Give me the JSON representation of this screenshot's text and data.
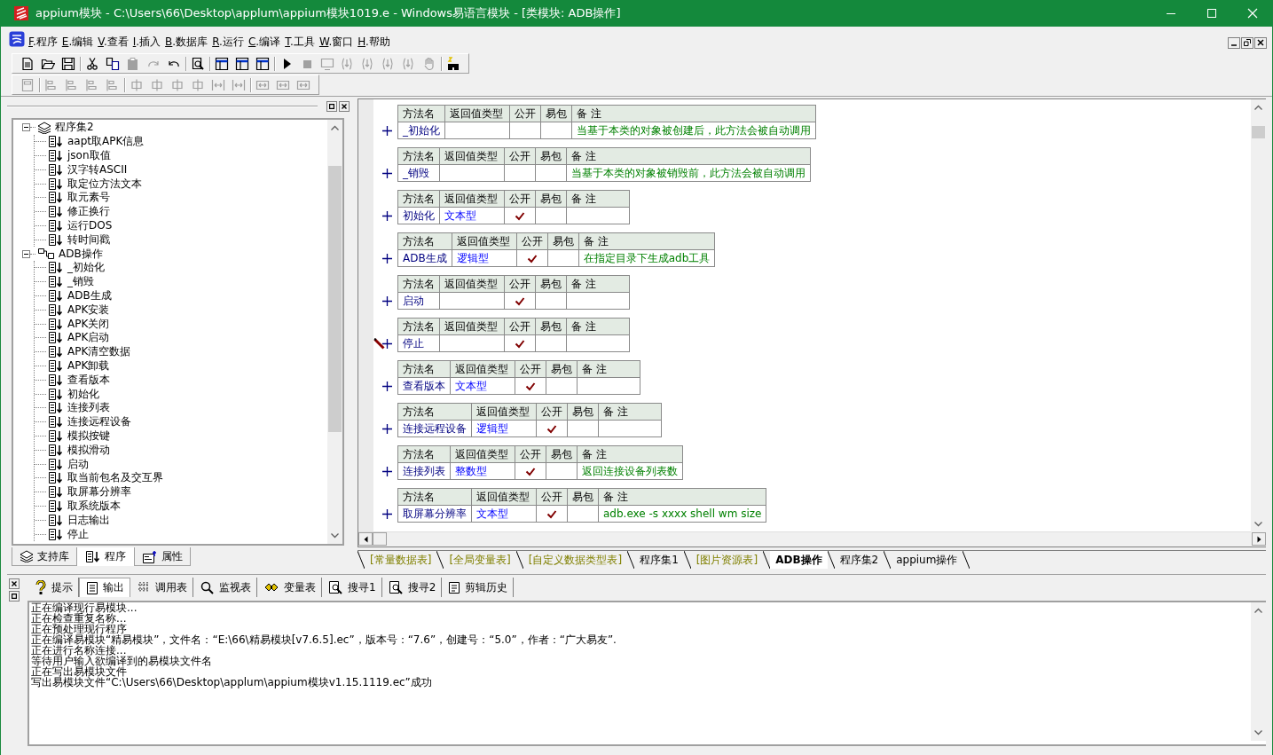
{
  "window": {
    "title": "appium模块 - C:\\Users\\66\\Desktop\\applum\\appium模块1019.e - Windows易语言模块 - [类模块: ADB操作]"
  },
  "menu": [
    {
      "label": "F.程序"
    },
    {
      "label": "E.编辑"
    },
    {
      "label": "V.查看"
    },
    {
      "label": "I.插入"
    },
    {
      "label": "B.数据库"
    },
    {
      "label": "R.运行"
    },
    {
      "label": "C.编译"
    },
    {
      "label": "T.工具"
    },
    {
      "label": "W.窗口"
    },
    {
      "label": "H.帮助"
    }
  ],
  "toolbars": [
    {
      "groups": [
        [
          {
            "kind": "new",
            "disabled": false
          },
          {
            "kind": "open",
            "disabled": false
          },
          {
            "kind": "save",
            "disabled": false
          }
        ],
        [
          {
            "kind": "cut",
            "disabled": false
          },
          {
            "kind": "copy",
            "disabled": false
          },
          {
            "kind": "paste",
            "disabled": true
          },
          {
            "kind": "redo",
            "disabled": true
          },
          {
            "kind": "undo",
            "disabled": false
          }
        ],
        [
          {
            "kind": "find",
            "disabled": false
          }
        ],
        [
          {
            "kind": "layout",
            "disabled": false
          },
          {
            "kind": "layout",
            "disabled": false
          },
          {
            "kind": "layout",
            "disabled": false
          }
        ],
        [
          {
            "kind": "run",
            "disabled": false
          },
          {
            "kind": "stop",
            "disabled": true
          },
          {
            "kind": "monitor",
            "disabled": true
          },
          {
            "kind": "step",
            "disabled": true
          },
          {
            "kind": "step",
            "disabled": true
          },
          {
            "kind": "step",
            "disabled": true
          },
          {
            "kind": "step",
            "disabled": true
          },
          {
            "kind": "hand",
            "disabled": true
          }
        ],
        [
          {
            "kind": "binoculars",
            "disabled": false
          }
        ]
      ]
    },
    {
      "groups": [
        [
          {
            "kind": "frame",
            "disabled": true
          }
        ],
        [
          {
            "kind": "align",
            "disabled": true
          },
          {
            "kind": "align",
            "disabled": true
          },
          {
            "kind": "align",
            "disabled": true
          },
          {
            "kind": "align",
            "disabled": true
          }
        ],
        [
          {
            "kind": "center",
            "disabled": true
          },
          {
            "kind": "center",
            "disabled": true
          },
          {
            "kind": "center",
            "disabled": true
          },
          {
            "kind": "center",
            "disabled": true
          },
          {
            "kind": "spacing",
            "disabled": true
          },
          {
            "kind": "spacing",
            "disabled": true
          }
        ],
        [
          {
            "kind": "resize",
            "disabled": true
          },
          {
            "kind": "resize",
            "disabled": true
          },
          {
            "kind": "resize",
            "disabled": true
          }
        ]
      ]
    }
  ],
  "side_panel": {
    "tree": [
      {
        "label": "程序集2",
        "kind": "module",
        "expanded": true,
        "children": [
          {
            "label": "aapt取APK信息"
          },
          {
            "label": "json取值"
          },
          {
            "label": "汉字转ASCII"
          },
          {
            "label": "取定位方法文本"
          },
          {
            "label": "取元素号"
          },
          {
            "label": "修正换行"
          },
          {
            "label": "运行DOS"
          },
          {
            "label": "转时间戳"
          }
        ]
      },
      {
        "label": "ADB操作",
        "kind": "class",
        "expanded": true,
        "children": [
          {
            "label": "_初始化"
          },
          {
            "label": "_销毁"
          },
          {
            "label": "ADB生成"
          },
          {
            "label": "APK安装"
          },
          {
            "label": "APK关闭"
          },
          {
            "label": "APK启动"
          },
          {
            "label": "APK清空数据"
          },
          {
            "label": "APK卸载"
          },
          {
            "label": "查看版本"
          },
          {
            "label": "初始化"
          },
          {
            "label": "连接列表"
          },
          {
            "label": "连接远程设备"
          },
          {
            "label": "模拟按键"
          },
          {
            "label": "模拟滑动"
          },
          {
            "label": "启动"
          },
          {
            "label": "取当前包名及交互界"
          },
          {
            "label": "取屏幕分辨率"
          },
          {
            "label": "取系统版本"
          },
          {
            "label": "日志输出"
          },
          {
            "label": "停止"
          }
        ]
      }
    ],
    "tabs": [
      {
        "label": "支持库",
        "kind": "library",
        "selected": false
      },
      {
        "label": "程序",
        "kind": "program",
        "selected": true
      },
      {
        "label": "属性",
        "kind": "properties",
        "selected": false
      }
    ]
  },
  "editor": {
    "methods": [
      {
        "headers": [
          "方法名",
          "返回值类型",
          "公开",
          "易包",
          "备 注"
        ],
        "name": "_初始化",
        "public": false,
        "easy_package": false,
        "remark": "当基于本类的对象被创建后，此方法会被自动调用",
        "editing": false
      },
      {
        "headers": [
          "方法名",
          "返回值类型",
          "公开",
          "易包",
          "备 注"
        ],
        "name": "_销毁",
        "public": false,
        "easy_package": false,
        "remark": "当基于本类的对象被销毁前，此方法会被自动调用",
        "editing": false
      },
      {
        "headers": [
          "方法名",
          "返回值类型",
          "公开",
          "易包",
          "备 注"
        ],
        "name": "初始化",
        "return_type": "文本型",
        "public": true,
        "easy_package": false,
        "editing": false
      },
      {
        "headers": [
          "方法名",
          "返回值类型",
          "公开",
          "易包",
          "备 注"
        ],
        "name": "ADB生成",
        "return_type": "逻辑型",
        "public": true,
        "easy_package": false,
        "remark": "在指定目录下生成adb工具",
        "editing": false
      },
      {
        "headers": [
          "方法名",
          "返回值类型",
          "公开",
          "易包",
          "备 注"
        ],
        "name": "启动",
        "public": true,
        "easy_package": false,
        "editing": false
      },
      {
        "headers": [
          "方法名",
          "返回值类型",
          "公开",
          "易包",
          "备 注"
        ],
        "name": "停止",
        "public": true,
        "easy_package": false,
        "editing": true
      },
      {
        "headers": [
          "方法名",
          "返回值类型",
          "公开",
          "易包",
          "备 注"
        ],
        "name": "查看版本",
        "return_type": "文本型",
        "public": true,
        "easy_package": false,
        "editing": false
      },
      {
        "headers": [
          "方法名",
          "返回值类型",
          "公开",
          "易包",
          "备 注"
        ],
        "name": "连接远程设备",
        "return_type": "逻辑型",
        "public": true,
        "easy_package": false,
        "editing": false
      },
      {
        "headers": [
          "方法名",
          "返回值类型",
          "公开",
          "易包",
          "备 注"
        ],
        "name": "连接列表",
        "return_type": "整数型",
        "public": true,
        "easy_package": false,
        "remark": "返回连接设备列表数",
        "editing": false
      },
      {
        "headers": [
          "方法名",
          "返回值类型",
          "公开",
          "易包",
          "备 注"
        ],
        "name": "取屏幕分辨率",
        "return_type": "文本型",
        "public": true,
        "easy_package": false,
        "remark": "adb.exe -s xxxx shell wm size",
        "editing": false
      }
    ],
    "tabs": [
      {
        "label": "[常量数据表]",
        "kind": "table",
        "selected": false
      },
      {
        "label": "[全局变量表]",
        "kind": "table",
        "selected": false
      },
      {
        "label": "[自定义数据类型表]",
        "kind": "table",
        "selected": false
      },
      {
        "label": "程序集1",
        "kind": "module",
        "selected": false
      },
      {
        "label": "[图片资源表]",
        "kind": "table",
        "selected": false
      },
      {
        "label": "ADB操作",
        "kind": "module",
        "selected": true
      },
      {
        "label": "程序集2",
        "kind": "module",
        "selected": false
      },
      {
        "label": "appium操作",
        "kind": "module",
        "selected": false
      }
    ]
  },
  "output_panel": {
    "tabs": [
      {
        "label": "提示",
        "kind": "hint",
        "selected": false
      },
      {
        "label": "输出",
        "kind": "output",
        "selected": true
      },
      {
        "label": "调用表",
        "kind": "calls",
        "selected": false
      },
      {
        "label": "监视表",
        "kind": "watch",
        "selected": false
      },
      {
        "label": "变量表",
        "kind": "vars",
        "selected": false
      },
      {
        "label": "搜寻1",
        "kind": "find",
        "selected": false
      },
      {
        "label": "搜寻2",
        "kind": "find",
        "selected": false
      },
      {
        "label": "剪辑历史",
        "kind": "clip",
        "selected": false
      }
    ],
    "lines": [
      "正在编译现行易模块...",
      "正在检查重复名称...",
      "正在预处理现行程序",
      "正在编译易模块“精易模块”，文件名：“E:\\66\\精易模块[v7.6.5].ec”，版本号：“7.6”，创建号：“5.0”，作者：“广大易友”.",
      "正在进行名称连接...",
      "等待用户输入欲编译到的易模块文件名",
      "正在写出易模块文件",
      "写出易模块文件“C:\\Users\\66\\Desktop\\applum\\appium模块v1.15.1119.ec”成功"
    ]
  }
}
